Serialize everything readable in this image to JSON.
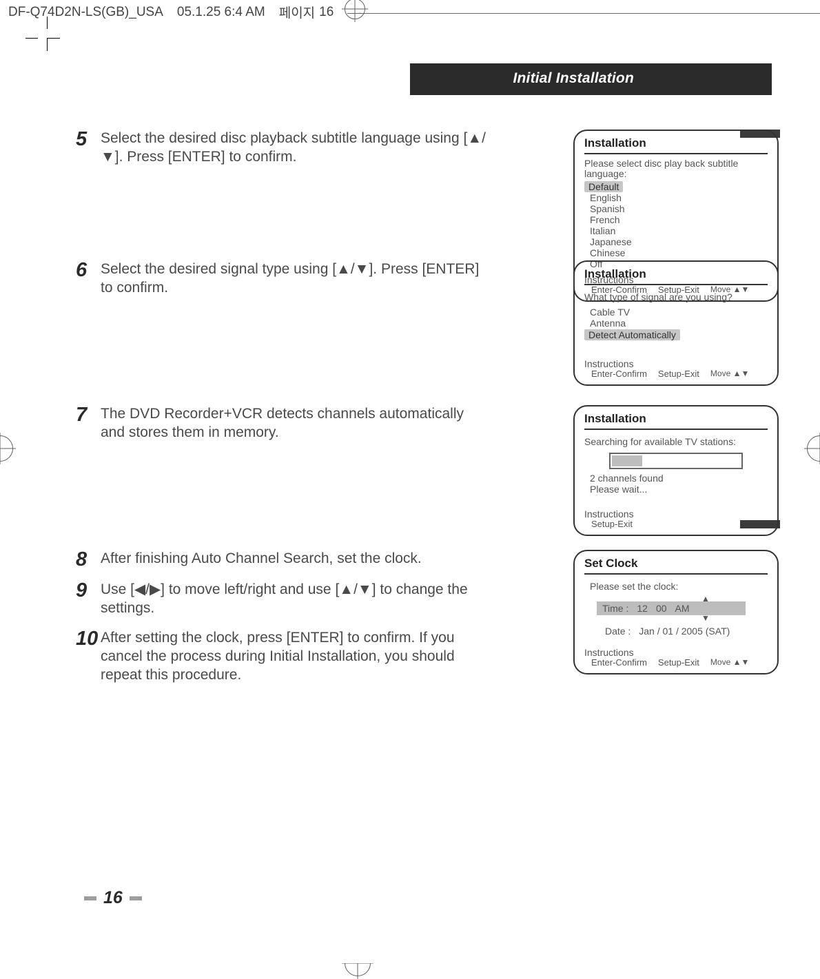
{
  "header": {
    "docname": "DF-Q74D2N-LS(GB)_USA",
    "meta": "05.1.25 6:4 AM",
    "pageno": "16"
  },
  "sectionTitle": "Initial Installation",
  "steps": {
    "s5": {
      "num": "5",
      "txt": "Select the desired disc playback subtitle language using [▲/▼]. Press [ENTER] to confirm."
    },
    "s6": {
      "num": "6",
      "txt": "Select the desired signal type using [▲/▼]. Press [ENTER] to confirm."
    },
    "s7": {
      "num": "7",
      "txt": "The DVD Recorder+VCR detects channels automatically and stores them in memory."
    },
    "s8": {
      "num": "8",
      "txt": "After finishing Auto Channel Search, set the clock."
    },
    "s9": {
      "num": "9",
      "txt": "Use [◀/▶] to move left/right and use [▲/▼] to change the settings."
    },
    "s10": {
      "num": "10",
      "txt": "After setting the clock, press [ENTER] to confirm. If you cancel the process during Initial Installation, you should repeat this procedure."
    }
  },
  "osd1": {
    "title": "Installation",
    "lead": "Please select disc play back subtitle language:",
    "options": [
      "Default",
      "English",
      "Spanish",
      "French",
      "Italian",
      "Japanese",
      "Chinese",
      "Off"
    ],
    "selectedIndex": 0,
    "instr": "Instructions",
    "foot": {
      "a": "Enter-Confirm",
      "b": "Setup-Exit",
      "c": "Move ▲▼"
    }
  },
  "osd2": {
    "title": "Installation",
    "lead": "What type of signal are you using?",
    "options": [
      "Cable TV",
      "Antenna",
      "Detect Automatically"
    ],
    "selectedIndex": 2,
    "instr": "Instructions",
    "foot": {
      "a": "Enter-Confirm",
      "b": "Setup-Exit",
      "c": "Move ▲▼"
    }
  },
  "osd3": {
    "title": "Installation",
    "lead": "Searching for available TV stations:",
    "status": "2 channels found",
    "wait": "Please wait...",
    "instr": "Instructions",
    "foot": {
      "a": "Setup-Exit"
    }
  },
  "osd4": {
    "title": "Set Clock",
    "lead": "Please set the clock:",
    "time_label": "Time :",
    "time_h": "12",
    "time_m": "00",
    "time_ampm": "AM",
    "date_label": "Date :",
    "date_val": "Jan / 01 / 2005  (SAT)",
    "instr": "Instructions",
    "foot": {
      "a": "Enter-Confirm",
      "b": "Setup-Exit",
      "c": "Move ▲▼"
    }
  },
  "bottomPage": "16"
}
